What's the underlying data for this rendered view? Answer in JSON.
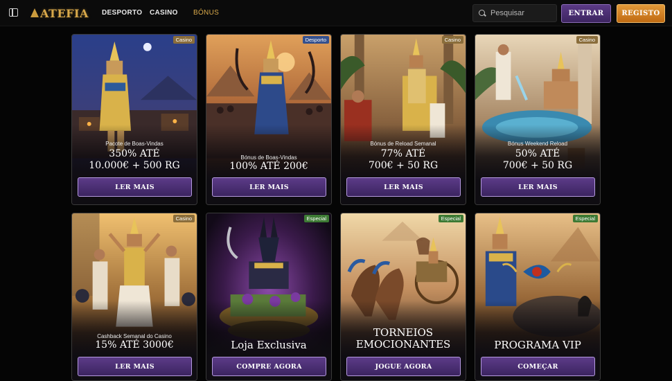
{
  "header": {
    "logo_text": "ATEFIA",
    "nav": [
      "DESPORTO",
      "CASINO",
      "BÓNUS"
    ],
    "search_placeholder": "Pesquisar",
    "login_label": "ENTRAR",
    "register_label": "REGISTO"
  },
  "colors": {
    "accent_gold": "#d9a94a",
    "button_purple": "#4b2f74",
    "register_orange": "#d98324",
    "badge_casino": "#8a6d3b",
    "badge_desporto": "#34508e",
    "badge_especial": "#3d7a34"
  },
  "cards": [
    {
      "badge": "Casino",
      "subtitle": "Pacote de Boas-Vindas",
      "line1": "350% ATÉ",
      "line2": "10.000€ + 500 RG",
      "cta": "LER MAIS",
      "art": "pharaoh-night-city"
    },
    {
      "badge": "Desporto",
      "subtitle": "Bónus de Boas-Vindas",
      "line1": "100% ATÉ 200€",
      "line2": "",
      "cta": "LER MAIS",
      "art": "pharaoh-pyramids-crowd"
    },
    {
      "badge": "Casino",
      "subtitle": "Bónus de Reload Semanal",
      "line1": "77% ATÉ",
      "line2": "700€ + 50 RG",
      "cta": "LER MAIS",
      "art": "pharaoh-throne"
    },
    {
      "badge": "Casino",
      "subtitle": "Bónus Weekend Reload",
      "line1": "50% ATÉ",
      "line2": "700€ + 50 RG",
      "cta": "LER MAIS",
      "art": "pharaoh-bath"
    },
    {
      "badge": "Casino",
      "subtitle": "Cashback Semanal do Casino",
      "line1": "15% ATÉ 3000€",
      "line2": "",
      "cta": "LER MAIS",
      "art": "pharaoh-celebration"
    },
    {
      "badge": "Especial",
      "subtitle": "",
      "line1": "Loja Exclusiva",
      "line2": "",
      "cta": "COMPRE AGORA",
      "art": "anubis-treasure"
    },
    {
      "badge": "Especial",
      "subtitle": "",
      "line1": "TORNEIOS",
      "line2": "EMOCIONANTES",
      "cta": "JOGUE AGORA",
      "art": "chariot-race"
    },
    {
      "badge": "Especial",
      "subtitle": "",
      "line1": "PROGRAMA VIP",
      "line2": "",
      "cta": "COMEÇAR",
      "art": "pharaoh-scarab"
    }
  ]
}
